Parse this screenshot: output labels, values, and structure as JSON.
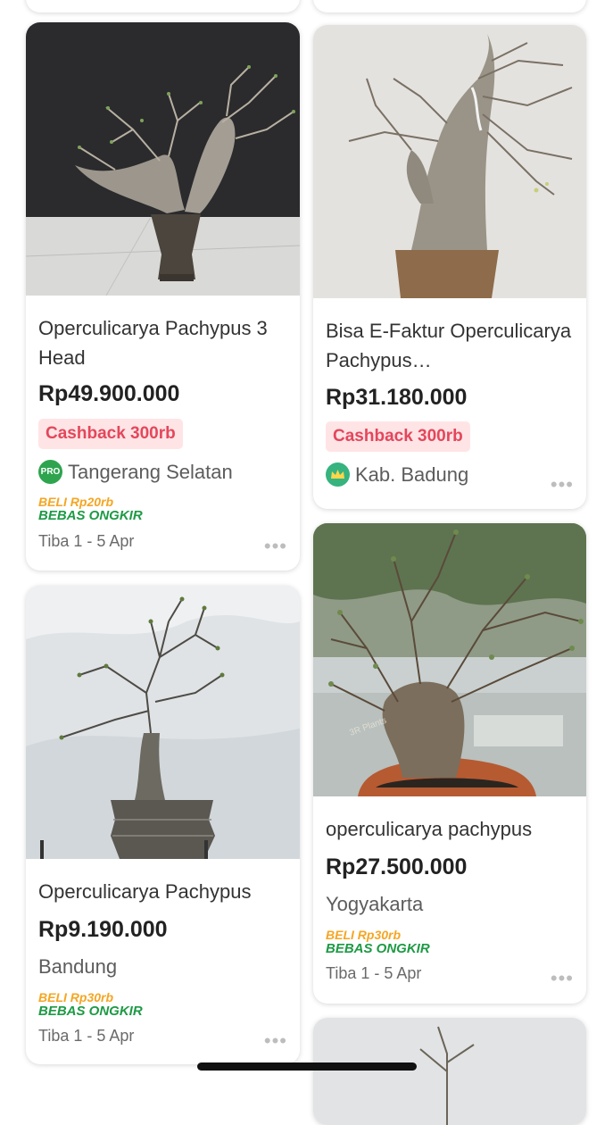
{
  "products": [
    {
      "title": "Operculicarya Pachypus 3 Head",
      "price": "Rp49.900.000",
      "cashback": "Cashback 300rb",
      "location": "Tangerang Selatan",
      "badge": "PRO",
      "badge_icon": "pro-badge-icon",
      "promo_line1": "BELI Rp20rb",
      "promo_line2": "BEBAS ONGKIR",
      "arrival": "Tiba 1 - 5 Apr",
      "more": "•••"
    },
    {
      "title": "Bisa E-Faktur Operculicarya Pachypus…",
      "price": "Rp31.180.000",
      "cashback": "Cashback 300rb",
      "location": "Kab. Badung",
      "badge_icon": "crown-badge-icon",
      "more": "•••"
    },
    {
      "title": "Operculicarya Pachypus",
      "price": "Rp9.190.000",
      "location": "Bandung",
      "promo_line1": "BELI Rp30rb",
      "promo_line2": "BEBAS ONGKIR",
      "arrival": "Tiba 1 - 5 Apr",
      "more": "•••"
    },
    {
      "title": "operculicarya pachypus",
      "price": "Rp27.500.000",
      "location": "Yogyakarta",
      "image_watermark": "3R Plants",
      "promo_line1": "BELI Rp30rb",
      "promo_line2": "BEBAS ONGKIR",
      "arrival": "Tiba 1 - 5 Apr",
      "more": "•••"
    }
  ],
  "colors": {
    "cashback_bg": "#ffe4e6",
    "cashback_text": "#e3475b",
    "promo_orange": "#f5a623",
    "promo_green": "#1d9a44",
    "pro_badge": "#2ea44f",
    "crown_badge": "#36b37e"
  }
}
